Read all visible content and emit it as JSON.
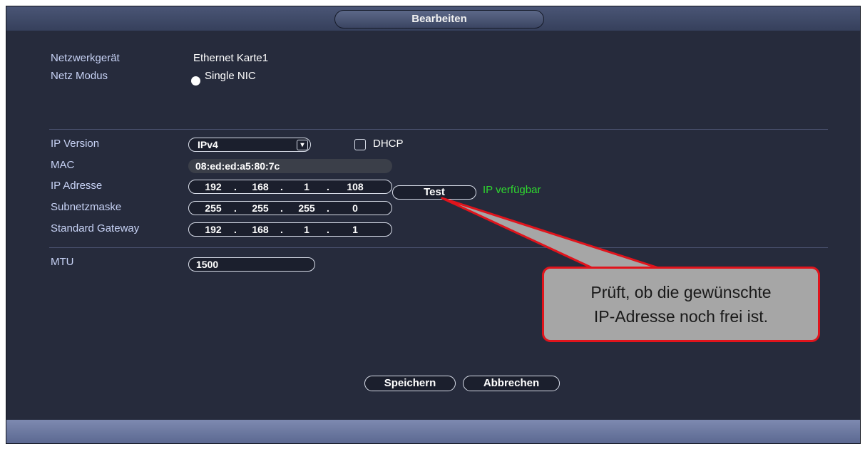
{
  "window": {
    "title": "Bearbeiten"
  },
  "network": {
    "device_label": "Netzwerkgerät",
    "device_value": "Ethernet Karte1",
    "mode_label": "Netz Modus",
    "mode_value": "Single NIC"
  },
  "ip": {
    "version_label": "IP Version",
    "version_value": "IPv4",
    "dhcp_label": "DHCP",
    "dhcp_checked": false,
    "mac_label": "MAC",
    "mac_value": "08:ed:ed:a5:80:7c",
    "address_label": "IP Adresse",
    "address": [
      "192",
      "168",
      "1",
      "108"
    ],
    "subnet_label": "Subnetzmaske",
    "subnet": [
      "255",
      "255",
      "255",
      "0"
    ],
    "gateway_label": "Standard Gateway",
    "gateway": [
      "192",
      "168",
      "1",
      "1"
    ],
    "test_label": "Test",
    "test_status": "IP verfügbar"
  },
  "mtu": {
    "label": "MTU",
    "value": "1500"
  },
  "footer": {
    "save_label": "Speichern",
    "cancel_label": "Abbrechen"
  },
  "callout": {
    "line1": "Prüft, ob die gewünschte",
    "line2": "IP-Adresse noch frei ist."
  },
  "colors": {
    "panel_bg": "#262b3c",
    "label_text": "#c8d3f6",
    "status_green": "#2fd82f",
    "callout_border": "#e0141c",
    "callout_fill": "#a6a6a6"
  }
}
